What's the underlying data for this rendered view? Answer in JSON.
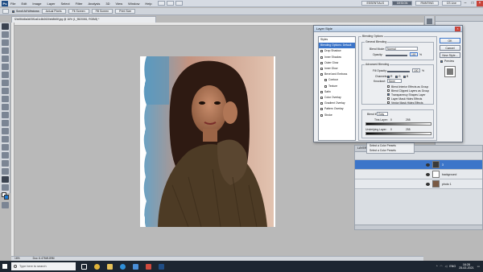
{
  "menubar": {
    "items": [
      "File",
      "Edit",
      "Image",
      "Layer",
      "Select",
      "Filter",
      "Analysis",
      "3D",
      "View",
      "Window",
      "Help"
    ],
    "workspaces": [
      "ESSENTIALS",
      "DESIGN",
      "PAINTING"
    ],
    "active_workspace": "DESIGN",
    "cs_live": "CS Live"
  },
  "optionsbar": {
    "scroll_all": "Scroll All Windows",
    "actual_pixels": "Actual Pixels",
    "fit_screen": "Fit Screen",
    "fill_screen": "Fill Screen",
    "print_size": "Print Size"
  },
  "document": {
    "tab_title": "f2b496d8a0d05f1a61c8b2630eb8fd5f.jpg @ 16% (1_5520081, RGB/8) *",
    "zoom": "16%",
    "doc_info": "Doc: 6.47M/6.89M"
  },
  "dialog": {
    "title": "Layer Style",
    "styles": [
      {
        "label": "Styles",
        "checkbox": false,
        "selected": false,
        "indent": false
      },
      {
        "label": "Blending Options: Default",
        "checkbox": false,
        "selected": true,
        "indent": false
      },
      {
        "label": "Drop Shadow",
        "checkbox": true,
        "selected": false,
        "indent": false
      },
      {
        "label": "Inner Shadow",
        "checkbox": true,
        "selected": false,
        "indent": false
      },
      {
        "label": "Outer Glow",
        "checkbox": true,
        "selected": false,
        "indent": false
      },
      {
        "label": "Inner Glow",
        "checkbox": true,
        "selected": false,
        "indent": false
      },
      {
        "label": "Bevel and Emboss",
        "checkbox": true,
        "selected": false,
        "indent": false
      },
      {
        "label": "Contour",
        "checkbox": true,
        "selected": false,
        "indent": true
      },
      {
        "label": "Texture",
        "checkbox": true,
        "selected": false,
        "indent": true
      },
      {
        "label": "Satin",
        "checkbox": true,
        "selected": false,
        "indent": false
      },
      {
        "label": "Color Overlay",
        "checkbox": true,
        "selected": false,
        "indent": false
      },
      {
        "label": "Gradient Overlay",
        "checkbox": true,
        "selected": false,
        "indent": false
      },
      {
        "label": "Pattern Overlay",
        "checkbox": true,
        "selected": false,
        "indent": false
      },
      {
        "label": "Stroke",
        "checkbox": true,
        "selected": false,
        "indent": false
      }
    ],
    "blending_options_title": "Blending Options",
    "general_blending_title": "General Blending",
    "blend_mode_label": "Blend Mode:",
    "blend_mode_value": "Normal",
    "opacity_label": "Opacity:",
    "opacity_value": "100",
    "percent": "%",
    "advanced_blending_title": "Advanced Blending",
    "fill_opacity_label": "Fill Opacity:",
    "fill_opacity_value": "100",
    "channels_label": "Channels:",
    "channels": [
      "R",
      "G",
      "B"
    ],
    "knockout_label": "Knockout:",
    "knockout_value": "None",
    "advanced_options": [
      "Blend Interior Effects as Group",
      "Blend Clipped Layers as Group",
      "Transparency Shapes Layer",
      "Layer Mask Hides Effects",
      "Vector Mask Hides Effects"
    ],
    "blend_if_label": "Blend If:",
    "blend_if_value": "Gray",
    "this_layer_label": "This Layer:",
    "underlying_layer_label": "Underlying Layer:",
    "range_min": "0",
    "range_max": "255",
    "buttons": {
      "ok": "OK",
      "cancel": "Cancel",
      "new_style": "New Style...",
      "preview": "Preview"
    }
  },
  "style_menu": [
    "Select a Color Presets",
    "Select a Color Presets"
  ],
  "layers": {
    "header": "LAYERS",
    "items": [
      {
        "name": "3",
        "selected": true
      },
      {
        "name": "background",
        "selected": false
      },
      {
        "name": "photo 1",
        "selected": false
      }
    ]
  },
  "taskbar": {
    "search_placeholder": "Type here to search",
    "language": "ENG",
    "time": "16:28",
    "date": "25-02-2021"
  },
  "colors": {
    "accent_blue": "#3c75c9",
    "workspace_bg": "#b9b9b9",
    "taskbar_bg": "#1d2631"
  }
}
